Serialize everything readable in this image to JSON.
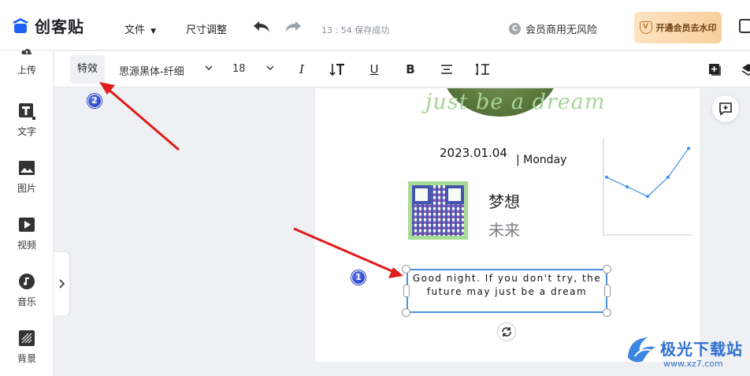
{
  "header": {
    "app_name": "创客贴",
    "menu_file": "文件",
    "menu_size": "尺寸调整",
    "save_status": "13 : 54 保存成功",
    "commercial_text": "会员商用无风险",
    "commercial_badge": "C",
    "vip_button": "开通会员去水印",
    "vip_badge": "V"
  },
  "sidebar": {
    "items": [
      {
        "label": "上传",
        "icon": "upload-icon"
      },
      {
        "label": "文字",
        "icon": "text-icon"
      },
      {
        "label": "图片",
        "icon": "image-icon"
      },
      {
        "label": "视频",
        "icon": "video-icon"
      },
      {
        "label": "音乐",
        "icon": "music-icon"
      },
      {
        "label": "背景",
        "icon": "background-icon"
      }
    ]
  },
  "toolbar": {
    "effects": "特效",
    "font": "思源黑体-纤细",
    "font_size": "18",
    "italic": "I",
    "underline": "U",
    "bold": "B"
  },
  "canvas": {
    "script_text": "just be a dream",
    "date": "2023.01.04",
    "weekday": "| Monday",
    "dream": "梦想",
    "future": "未来",
    "selected_text": "Good night. If you don't try, the future may just be a dream"
  },
  "chart_data": {
    "type": "line",
    "series": [
      {
        "values": [
          40,
          35,
          30,
          40,
          55
        ]
      }
    ],
    "ylim": [
      10,
      60
    ],
    "color": "#3d8fef"
  },
  "annotations": {
    "marker1": "1",
    "marker2": "2",
    "arrow_color": "#e01b1b"
  },
  "watermark": {
    "main": "极光下载站",
    "url": "www.xz7.com"
  }
}
